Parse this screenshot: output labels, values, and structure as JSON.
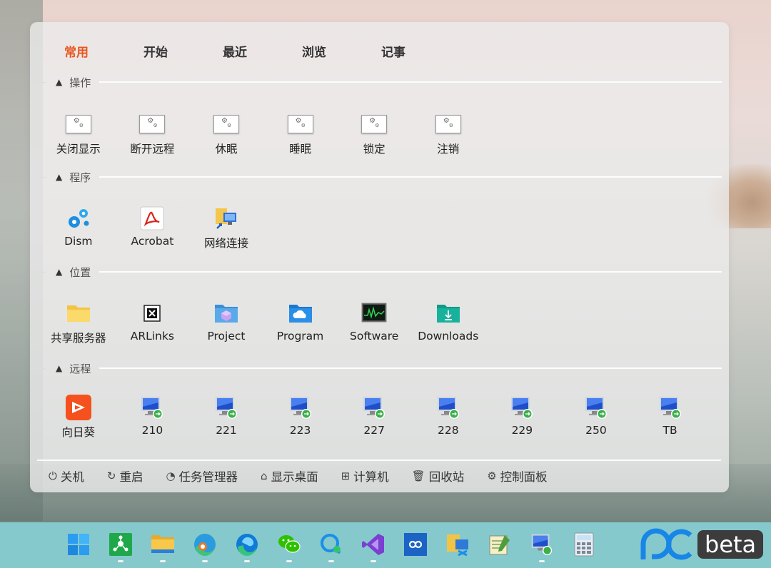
{
  "tabs": [
    {
      "label": "常用",
      "active": true
    },
    {
      "label": "开始",
      "active": false
    },
    {
      "label": "最近",
      "active": false
    },
    {
      "label": "浏览",
      "active": false
    },
    {
      "label": "记事",
      "active": false
    }
  ],
  "sections": {
    "operations": {
      "title": "操作",
      "items": [
        {
          "label": "关闭显示",
          "icon": "gear-tile-icon"
        },
        {
          "label": "断开远程",
          "icon": "gear-tile-icon"
        },
        {
          "label": "休眠",
          "icon": "gear-tile-icon"
        },
        {
          "label": "睡眠",
          "icon": "gear-tile-icon"
        },
        {
          "label": "锁定",
          "icon": "gear-tile-icon"
        },
        {
          "label": "注销",
          "icon": "gear-tile-icon"
        }
      ]
    },
    "programs": {
      "title": "程序",
      "items": [
        {
          "label": "Dism",
          "icon": "gears-icon"
        },
        {
          "label": "Acrobat",
          "icon": "acrobat-icon"
        },
        {
          "label": "网络连接",
          "icon": "network-connections-icon"
        }
      ]
    },
    "locations": {
      "title": "位置",
      "items": [
        {
          "label": "共享服务器",
          "icon": "folder-icon"
        },
        {
          "label": "ARLinks",
          "icon": "close-box-icon"
        },
        {
          "label": "Project",
          "icon": "cube-folder-icon"
        },
        {
          "label": "Program",
          "icon": "cloud-folder-icon"
        },
        {
          "label": "Software",
          "icon": "monitor-chart-icon"
        },
        {
          "label": "Downloads",
          "icon": "download-folder-icon"
        }
      ]
    },
    "remote": {
      "title": "远程",
      "items": [
        {
          "label": "向日葵",
          "icon": "sunlogin-icon"
        },
        {
          "label": "210",
          "icon": "remote-desktop-icon"
        },
        {
          "label": "221",
          "icon": "remote-desktop-icon"
        },
        {
          "label": "223",
          "icon": "remote-desktop-icon"
        },
        {
          "label": "227",
          "icon": "remote-desktop-icon"
        },
        {
          "label": "228",
          "icon": "remote-desktop-icon"
        },
        {
          "label": "229",
          "icon": "remote-desktop-icon"
        },
        {
          "label": "250",
          "icon": "remote-desktop-icon"
        },
        {
          "label": "TB",
          "icon": "remote-desktop-icon"
        }
      ]
    }
  },
  "footer": {
    "shutdown": "关机",
    "restart": "重启",
    "task_manager": "任务管理器",
    "show_desktop": "显示桌面",
    "computer": "计算机",
    "recycle_bin": "回收站",
    "control_panel": "控制面板"
  },
  "taskbar": {
    "icons": [
      "windows-start-icon",
      "network-app-icon",
      "file-explorer-icon",
      "edge-canary-icon",
      "edge-icon",
      "wechat-icon",
      "quickq-icon",
      "visual-studio-icon",
      "infinity-app-icon",
      "network-tool-icon",
      "notepad-icon",
      "remote-desktop-icon",
      "calculator-icon"
    ],
    "logo_text": "beta"
  },
  "colors": {
    "accent": "#e8561e",
    "taskbar": "#85c9cd"
  }
}
